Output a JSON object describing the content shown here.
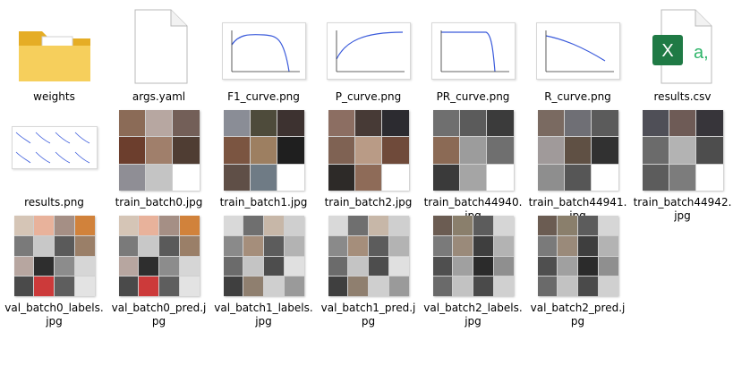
{
  "files": [
    {
      "name": "weights",
      "kind": "folder"
    },
    {
      "name": "args.yaml",
      "kind": "document"
    },
    {
      "name": "F1_curve.png",
      "kind": "plot"
    },
    {
      "name": "P_curve.png",
      "kind": "plot"
    },
    {
      "name": "PR_curve.png",
      "kind": "plot"
    },
    {
      "name": "R_curve.png",
      "kind": "plot"
    },
    {
      "name": "results.csv",
      "kind": "excel"
    },
    {
      "name": "results.png",
      "kind": "results-plot"
    },
    {
      "name": "train_batch0.jpg",
      "kind": "mosaic"
    },
    {
      "name": "train_batch1.jpg",
      "kind": "mosaic"
    },
    {
      "name": "train_batch2.jpg",
      "kind": "mosaic"
    },
    {
      "name": "train_batch44940.jpg",
      "kind": "mosaic"
    },
    {
      "name": "train_batch44941.jpg",
      "kind": "mosaic"
    },
    {
      "name": "train_batch44942.jpg",
      "kind": "mosaic"
    },
    {
      "name": "val_batch0_labels.jpg",
      "kind": "mosaic"
    },
    {
      "name": "val_batch0_pred.jpg",
      "kind": "mosaic"
    },
    {
      "name": "val_batch1_labels.jpg",
      "kind": "mosaic"
    },
    {
      "name": "val_batch1_pred.jpg",
      "kind": "mosaic"
    },
    {
      "name": "val_batch2_labels.jpg",
      "kind": "mosaic"
    },
    {
      "name": "val_batch2_pred.jpg",
      "kind": "mosaic"
    }
  ],
  "icons": {
    "folder": "folder-icon",
    "document": "document-icon",
    "excel": "excel-icon"
  },
  "excel_letters": {
    "main": "X",
    "secondary": "a,"
  },
  "colors": {
    "folder": "#f3c64a",
    "folder_dark": "#e5ad25",
    "excel_green": "#1f7a45",
    "excel_light": "#2fb56a",
    "plot_line": "#3b5bdb"
  }
}
